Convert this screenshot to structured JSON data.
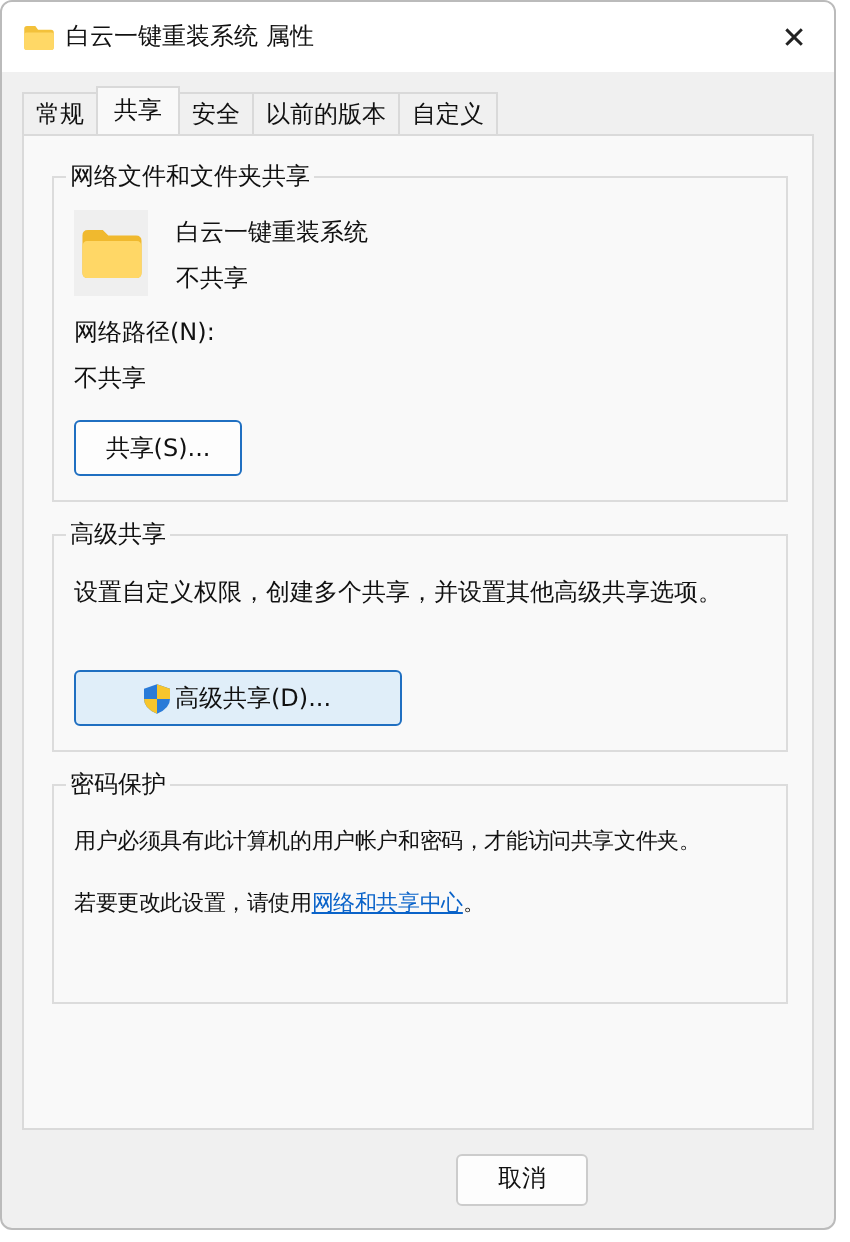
{
  "window": {
    "title": "白云一键重装系统 属性",
    "close": "✕"
  },
  "tabs": [
    {
      "label": "常规",
      "selected": false
    },
    {
      "label": "共享",
      "selected": true
    },
    {
      "label": "安全",
      "selected": false
    },
    {
      "label": "以前的版本",
      "selected": false
    },
    {
      "label": "自定义",
      "selected": false
    }
  ],
  "network_sharing": {
    "title": "网络文件和文件夹共享",
    "folder_name": "白云一键重装系统",
    "status": "不共享",
    "path_label": "网络路径(N):",
    "path_value": "不共享",
    "button": "共享(S)..."
  },
  "advanced_sharing": {
    "title": "高级共享",
    "description": "设置自定义权限，创建多个共享，并设置其他高级共享选项。",
    "button": "高级共享(D)..."
  },
  "password_protection": {
    "title": "密码保护",
    "description": "用户必须具有此计算机的用户帐户和密码，才能访问共享文件夹。",
    "link_prefix": "若要更改此设置，请使用",
    "link": "网络和共享中心",
    "link_suffix": "。"
  },
  "buttons": [
    "取消"
  ]
}
